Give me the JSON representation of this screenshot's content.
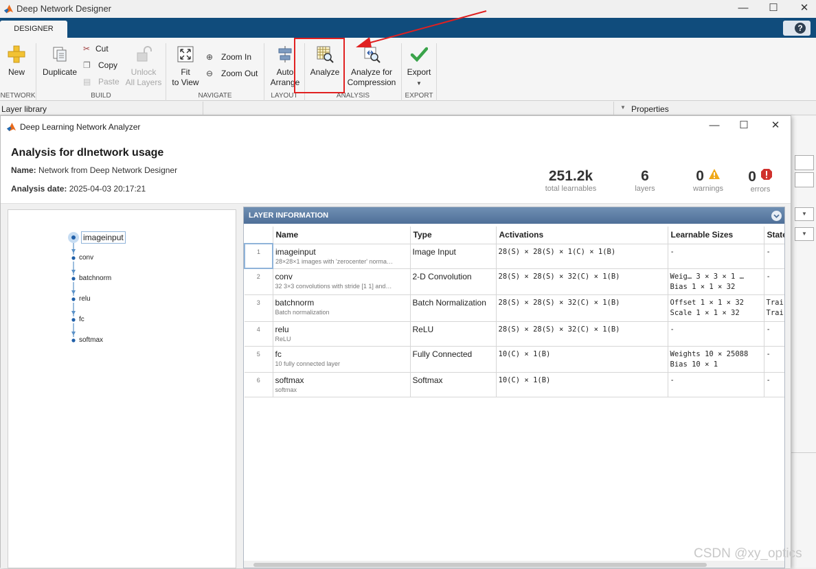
{
  "window": {
    "title": "Deep Network Designer",
    "controls": [
      "—",
      "☐",
      "✕"
    ]
  },
  "tabs": {
    "designer": "DESIGNER",
    "help": "?"
  },
  "ribbon": {
    "network": {
      "new_label": "New",
      "group": "NETWORK"
    },
    "build": {
      "duplicate_label": "Duplicate",
      "cut_label": "Cut",
      "copy_label": "Copy",
      "paste_label": "Paste",
      "unlock_label_1": "Unlock",
      "unlock_label_2": "All Layers",
      "group": "BUILD"
    },
    "navigate": {
      "fit_label_1": "Fit",
      "fit_label_2": "to View",
      "zoom_in_label": "Zoom In",
      "zoom_out_label": "Zoom Out",
      "group": "NAVIGATE"
    },
    "layout": {
      "auto_label_1": "Auto",
      "auto_label_2": "Arrange",
      "group": "LAYOUT"
    },
    "analysis": {
      "analyze_label": "Analyze",
      "compression_label_1": "Analyze for",
      "compression_label_2": "Compression",
      "group": "ANALYSIS"
    },
    "export": {
      "export_label": "Export",
      "group": "EXPORT"
    }
  },
  "panels": {
    "layer_library": "Layer library",
    "properties": "Properties"
  },
  "analyzer": {
    "window_title": "Deep Learning Network Analyzer",
    "heading": "Analysis for dlnetwork usage",
    "name_key": "Name:",
    "name_value": "Network from Deep Network Designer",
    "date_key": "Analysis date:",
    "date_value": "2025-04-03 20:17:21",
    "stats": {
      "learnables": "251.2k",
      "learnables_label": "total learnables",
      "layers": "6",
      "layers_label": "layers",
      "warnings": "0",
      "warnings_label": "warnings",
      "errors": "0",
      "errors_label": "errors"
    },
    "graph_nodes": [
      "imageinput",
      "conv",
      "batchnorm",
      "relu",
      "fc",
      "softmax"
    ],
    "table": {
      "title": "LAYER INFORMATION",
      "headers": [
        "Name",
        "Type",
        "Activations",
        "Learnable Sizes",
        "State"
      ],
      "rows": [
        {
          "index": "1",
          "name": "imageinput",
          "desc": "28×28×1 images with 'zerocenter' norma…",
          "type": "Image Input",
          "activations": "28(S) × 28(S) × 1(C) × 1(B)",
          "learn1": "-",
          "learn2": "",
          "state1": "-",
          "state2": ""
        },
        {
          "index": "2",
          "name": "conv",
          "desc": "32 3×3 convolutions with stride [1 1] and…",
          "type": "2-D Convolution",
          "activations": "28(S) × 28(S) × 32(C) × 1(B)",
          "learn1": "Weig…  3 × 3 × 1 …",
          "learn2": "Bias   1 × 1 × 32",
          "state1": "-",
          "state2": ""
        },
        {
          "index": "3",
          "name": "batchnorm",
          "desc": "Batch normalization",
          "type": "Batch Normalization",
          "activations": "28(S) × 28(S) × 32(C) × 1(B)",
          "learn1": "Offset  1 × 1 × 32",
          "learn2": "Scale   1 × 1 × 32",
          "state1": "Trai",
          "state2": "Trai"
        },
        {
          "index": "4",
          "name": "relu",
          "desc": "ReLU",
          "type": "ReLU",
          "activations": "28(S) × 28(S) × 32(C) × 1(B)",
          "learn1": "-",
          "learn2": "",
          "state1": "-",
          "state2": ""
        },
        {
          "index": "5",
          "name": "fc",
          "desc": "10 fully connected layer",
          "type": "Fully Connected",
          "activations": "10(C) × 1(B)",
          "learn1": "Weights  10 × 25088",
          "learn2": "Bias     10 × 1",
          "state1": "-",
          "state2": ""
        },
        {
          "index": "6",
          "name": "softmax",
          "desc": "softmax",
          "type": "Softmax",
          "activations": "10(C) × 1(B)",
          "learn1": "-",
          "learn2": "",
          "state1": "-",
          "state2": ""
        }
      ]
    }
  },
  "watermark": "CSDN @xy_optics",
  "colors": {
    "tab_bar": "#104c7c",
    "panel_header": "#5a7aa3",
    "highlight_box": "#e02020",
    "arrow": "#e02020"
  }
}
